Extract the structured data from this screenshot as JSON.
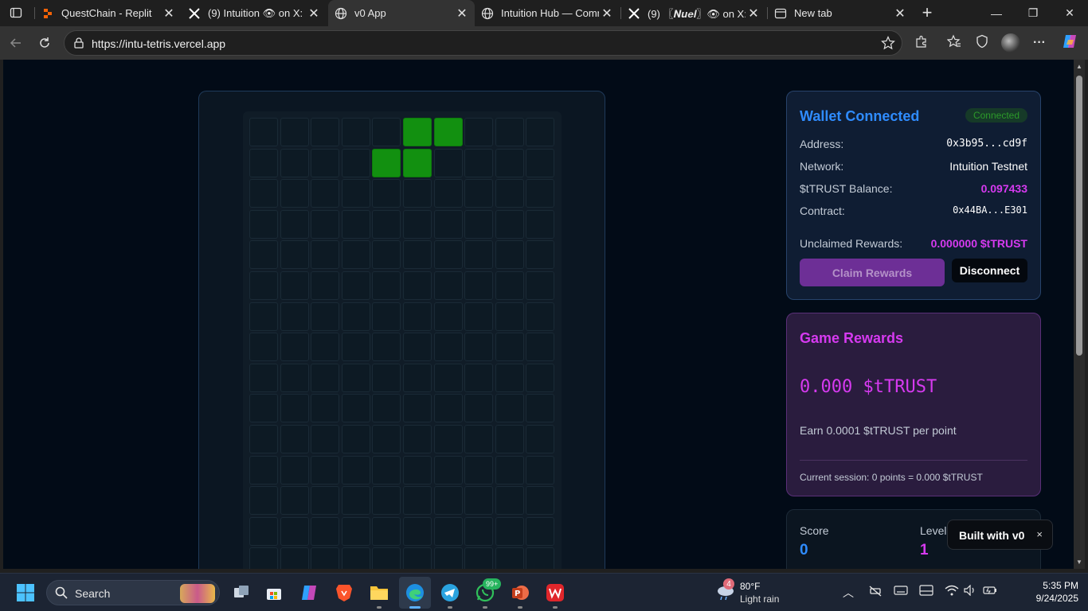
{
  "browser": {
    "tabs": [
      {
        "label": "QuestChain - Replit",
        "icon": "replit-icon",
        "active": false
      },
      {
        "label": "(9) Intuition 👁 on X: \"",
        "icon": "x-logo-icon",
        "active": false
      },
      {
        "label": "v0 App",
        "icon": "globe-icon",
        "active": true
      },
      {
        "label": "Intuition Hub — Comm",
        "icon": "globe-icon",
        "active": false
      },
      {
        "label": "(9) 〖𝑵𝒖𝒆𝒍〗👁 on X:",
        "icon": "x-logo-icon",
        "active": false
      },
      {
        "label": "New tab",
        "icon": "newtab-icon",
        "active": false
      }
    ],
    "url": "https://intu-tetris.vercel.app"
  },
  "wallet": {
    "title": "Wallet Connected",
    "status_badge": "Connected",
    "rows": [
      {
        "label": "Address:",
        "value": "0x3b95...cd9f"
      },
      {
        "label": "Network:",
        "value": "Intuition Testnet"
      },
      {
        "label": "$tTRUST Balance:",
        "value": "0.097433"
      },
      {
        "label": "Contract:",
        "value": "0x44BA...E301"
      }
    ],
    "unclaimed_label": "Unclaimed Rewards:",
    "unclaimed_value": "0.000000 $tTRUST",
    "claim_button": "Claim Rewards",
    "disconnect_button": "Disconnect"
  },
  "rewards": {
    "title": "Game Rewards",
    "amount": "0.000 $tTRUST",
    "earn_rate": "Earn 0.0001 $tTRUST per point",
    "session": "Current session: 0 points = 0.000 $tTRUST"
  },
  "stats": {
    "score_label": "Score",
    "score": "0",
    "level_label": "Level",
    "level": "1"
  },
  "v0_badge": {
    "label": "Built with v0",
    "close": "×"
  },
  "board": {
    "visible_rows": 15,
    "cols": 10,
    "filled_cells": [
      [
        0,
        5
      ],
      [
        0,
        6
      ],
      [
        1,
        4
      ],
      [
        1,
        5
      ]
    ],
    "piece_color": "#129010"
  },
  "taskbar": {
    "search_placeholder": "Search",
    "weather": {
      "temp": "80°F",
      "condition": "Light rain",
      "notification_count": "4"
    },
    "whatsapp_badge": "99+",
    "time": "5:35 PM",
    "date": "9/24/2025"
  }
}
